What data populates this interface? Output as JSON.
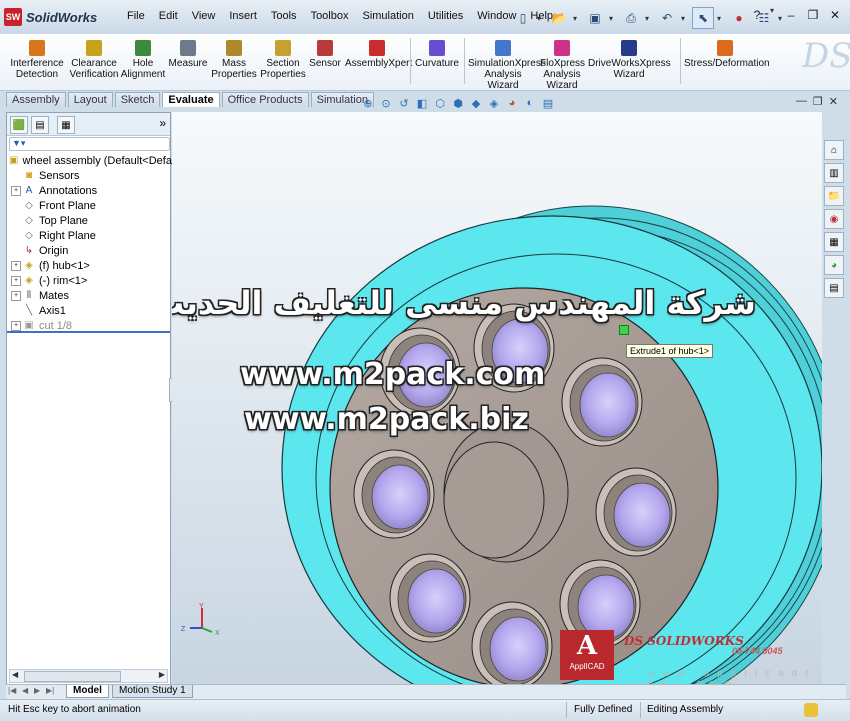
{
  "app": {
    "name": "SolidWorks",
    "logo_text": "SW"
  },
  "menu": [
    "File",
    "Edit",
    "View",
    "Insert",
    "Tools",
    "Toolbox",
    "Simulation",
    "Utilities",
    "Window",
    "Help"
  ],
  "command_manager": [
    {
      "label": "Interference\nDetection",
      "icon": "interference-icon",
      "color": "#d8761e"
    },
    {
      "label": "Clearance\nVerification",
      "icon": "clearance-icon",
      "color": "#c9a21b"
    },
    {
      "label": "Hole\nAlignment",
      "icon": "hole-alignment-icon",
      "color": "#3c8a3c"
    },
    {
      "label": "Measure",
      "icon": "measure-icon",
      "color": "#6c7a8a"
    },
    {
      "label": "Mass\nProperties",
      "icon": "scale-icon",
      "color": "#b08a2a"
    },
    {
      "label": "Section\nProperties",
      "icon": "section-icon",
      "color": "#c8a030"
    },
    {
      "label": "Sensor",
      "icon": "sensor-icon",
      "color": "#b83a3a"
    },
    {
      "label": "AssemblyXpert",
      "icon": "assemblyxpert-icon",
      "color": "#c92d2d"
    },
    {
      "label": "Curvature",
      "icon": "curvature-icon",
      "color": "#6a4ccf"
    },
    {
      "label": "SimulationXpress\nAnalysis Wizard",
      "icon": "simulationxpress-icon",
      "color": "#4477cc"
    },
    {
      "label": "FloXpress\nAnalysis\nWizard",
      "icon": "floxpress-icon",
      "color": "#cc3388"
    },
    {
      "label": "DriveWorksXpress\nWizard",
      "icon": "driveworks-icon",
      "color": "#2a3a8a"
    },
    {
      "label": "Stress/Deformation",
      "icon": "stress-icon",
      "color": "#dd6a1a"
    }
  ],
  "tabs": [
    "Assembly",
    "Layout",
    "Sketch",
    "Evaluate",
    "Office Products",
    "Simulation"
  ],
  "active_tab": "Evaluate",
  "feature_tree": {
    "filter_icon": "filter-icon",
    "nodes": [
      {
        "label": "wheel assembly  (Default<Defau",
        "icon": "assembly-icon",
        "expander": "",
        "indent": 0
      },
      {
        "label": "Sensors",
        "icon": "sensor-folder-icon",
        "expander": "",
        "indent": 1
      },
      {
        "label": "Annotations",
        "icon": "annotations-icon",
        "expander": "+",
        "indent": 1
      },
      {
        "label": "Front Plane",
        "icon": "plane-icon",
        "expander": "",
        "indent": 1
      },
      {
        "label": "Top Plane",
        "icon": "plane-icon",
        "expander": "",
        "indent": 1
      },
      {
        "label": "Right Plane",
        "icon": "plane-icon",
        "expander": "",
        "indent": 1
      },
      {
        "label": "Origin",
        "icon": "origin-icon",
        "expander": "",
        "indent": 1
      },
      {
        "label": "(f) hub<1>",
        "icon": "part-icon",
        "expander": "+",
        "indent": 1
      },
      {
        "label": "(-) rim<1>",
        "icon": "part-icon",
        "expander": "+",
        "indent": 1
      },
      {
        "label": "Mates",
        "icon": "mates-icon",
        "expander": "+",
        "indent": 1
      },
      {
        "label": "Axis1",
        "icon": "axis-icon",
        "expander": "",
        "indent": 1
      },
      {
        "label": "cut 1/8",
        "icon": "cut-icon",
        "expander": "+",
        "indent": 1,
        "suppressed": true
      }
    ]
  },
  "graphics": {
    "watermark_arabic": "شركة المهندس منسى للتغليف الحديث",
    "watermark_url1": "www.m2pack.com",
    "watermark_url2": "www.m2pack.biz",
    "tooltip": "Extrude1 of hub<1>",
    "triad_labels": {
      "x": "X",
      "y": "Y",
      "z": "Z"
    },
    "applicad_label": "ApplICAD",
    "solidworks_mark": "DS SOLIDWORKS",
    "phone": "05-744 9045",
    "website": "w w w . a p p l i c a d t h a i . c o m",
    "colors": {
      "rim": "#5ce6ee",
      "hub": "#a79c95",
      "bore": "#b7aaf1"
    }
  },
  "bottom_tabs": [
    "Model",
    "Motion Study 1"
  ],
  "active_bottom_tab": "Model",
  "status": {
    "message": "Hit Esc key to abort animation",
    "definition": "Fully Defined",
    "mode": "Editing Assembly"
  }
}
